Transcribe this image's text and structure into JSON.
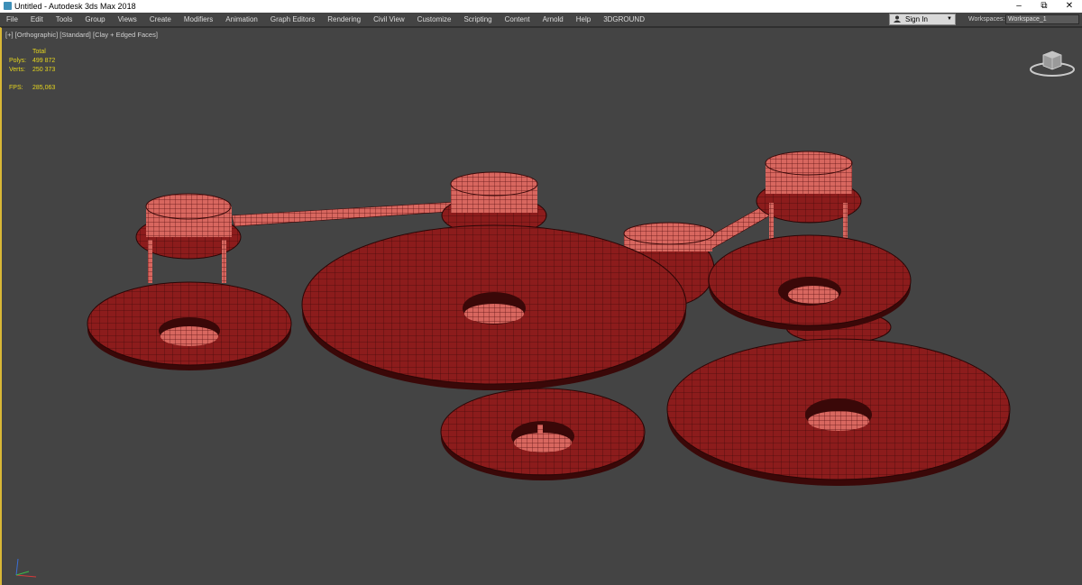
{
  "window": {
    "title": "Untitled - Autodesk 3ds Max 2018"
  },
  "menu": {
    "items": [
      "File",
      "Edit",
      "Tools",
      "Group",
      "Views",
      "Create",
      "Modifiers",
      "Animation",
      "Graph Editors",
      "Rendering",
      "Civil View",
      "Customize",
      "Scripting",
      "Content",
      "Arnold",
      "Help",
      "3DGROUND"
    ],
    "sign_in": "Sign In",
    "workspaces_label": "Workspaces:",
    "workspace_value": "Workspace_1"
  },
  "viewport": {
    "plus": "[+]",
    "view": "[Orthographic]",
    "shading_standard": "[Standard]",
    "shading_mode": "[Clay + Edged Faces]"
  },
  "stats": {
    "header": "Total",
    "polys_label": "Polys:",
    "polys_value": "499 872",
    "verts_label": "Verts:",
    "verts_value": "250 373",
    "fps_label": "FPS:",
    "fps_value": "285,063"
  },
  "colors": {
    "viewport_bg": "#444444",
    "model_fill": "#d4625c",
    "wire": "#4a0c0c",
    "active_border": "#d9b836",
    "stats_text": "#e6d61e"
  },
  "icons": [
    "app-icon",
    "minimize-icon",
    "maximize-icon",
    "close-icon",
    "user-icon",
    "dropdown-arrow-icon",
    "viewcube-icon",
    "axis-tripod-icon"
  ]
}
